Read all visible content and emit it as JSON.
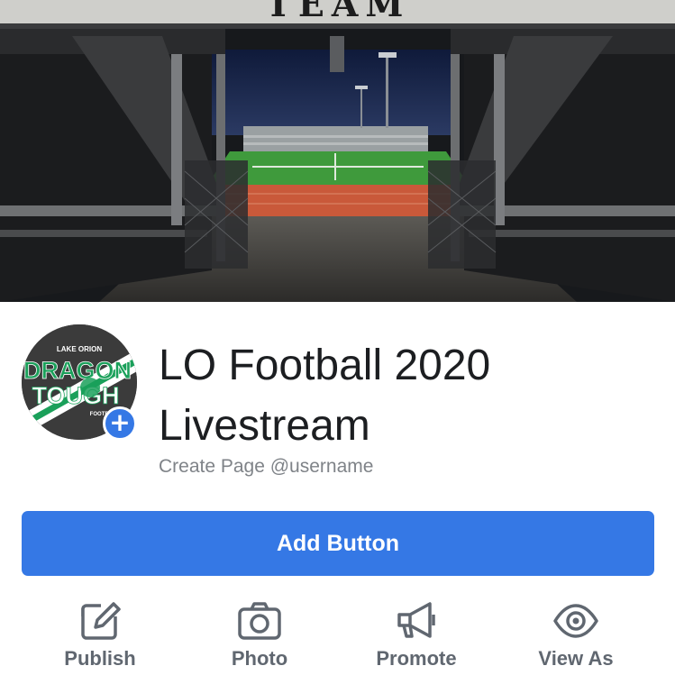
{
  "cover": {
    "sign_text": "TEAM"
  },
  "profile": {
    "logo_text_top": "LAKE ORION",
    "logo_text_line1": "DRAGON",
    "logo_text_line2": "TOUGH",
    "logo_text_bottom": "FOOTBALL",
    "add_badge": "+"
  },
  "page": {
    "title_line1": "LO Football 2020",
    "title_line2": "Livestream",
    "username": "Create Page @username"
  },
  "primary_button": {
    "label": "Add Button"
  },
  "actions": [
    {
      "label": "Publish",
      "icon": "edit-icon"
    },
    {
      "label": "Photo",
      "icon": "camera-icon"
    },
    {
      "label": "Promote",
      "icon": "megaphone-icon"
    },
    {
      "label": "View As",
      "icon": "eye-icon"
    }
  ],
  "colors": {
    "accent": "#3578e5",
    "title": "#1c1e21",
    "secondary_text": "#7f8388",
    "action_text": "#606770",
    "logo_green": "#1aa05a"
  }
}
